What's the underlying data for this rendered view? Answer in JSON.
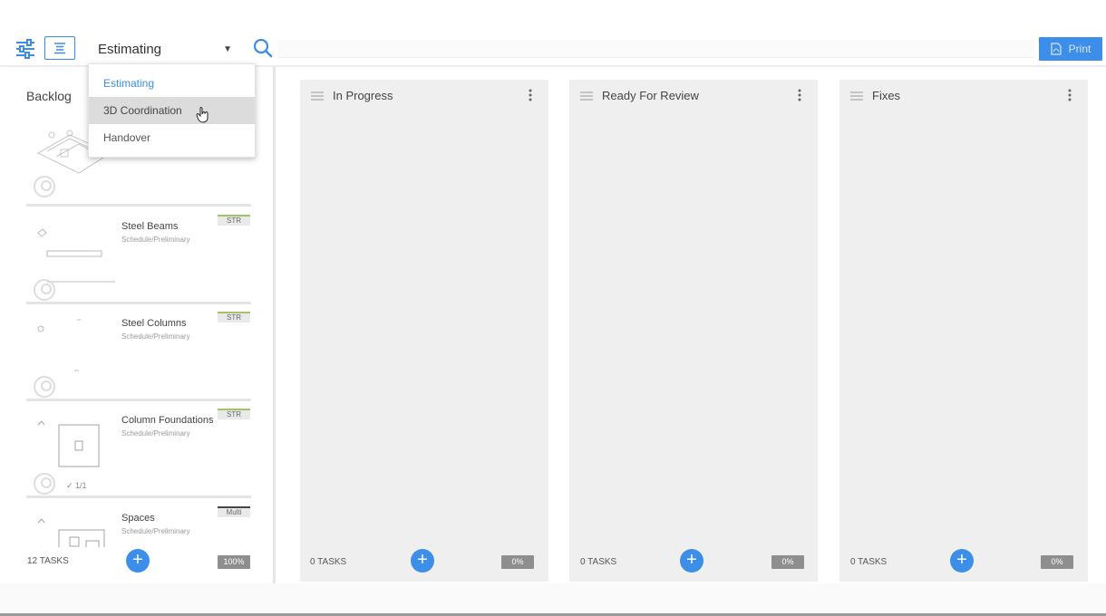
{
  "toolbar": {
    "board_name": "Estimating",
    "print_label": "Print"
  },
  "dropdown": {
    "options": [
      "Estimating",
      "3D Coordination",
      "Handover"
    ],
    "selected": "Estimating",
    "hovered": "3D Coordination"
  },
  "backlog": {
    "title": "Backlog",
    "task_count": "12 TASKS",
    "percent": "100%",
    "cards": [
      {
        "title": "",
        "subtitle": "",
        "tag": ""
      },
      {
        "title": "Steel Beams",
        "subtitle": "Schedule/Preliminary",
        "tag": "STR"
      },
      {
        "title": "Steel Columns",
        "subtitle": "Schedule/Preliminary",
        "tag": "STR"
      },
      {
        "title": "Column Foundations",
        "subtitle": "Schedule/Preliminary",
        "tag": "STR",
        "checklist": "1/1"
      },
      {
        "title": "Spaces",
        "subtitle": "Schedule/Preliminary",
        "tag": "Multi"
      }
    ]
  },
  "columns": [
    {
      "title": "In Progress",
      "task_count": "0 TASKS",
      "percent": "0%"
    },
    {
      "title": "Ready For Review",
      "task_count": "0 TASKS",
      "percent": "0%"
    },
    {
      "title": "Fixes",
      "task_count": "0 TASKS",
      "percent": "0%"
    }
  ],
  "colors": {
    "accent": "#3c8ee8",
    "column_bg": "#efefef",
    "tag_green": "#9ec566"
  },
  "icons": [
    "filter-icon",
    "list-view-icon",
    "search-icon",
    "pdf-icon",
    "more-vert-icon",
    "drag-handle-icon",
    "add-icon",
    "avatar-icon",
    "hand-cursor-icon"
  ]
}
